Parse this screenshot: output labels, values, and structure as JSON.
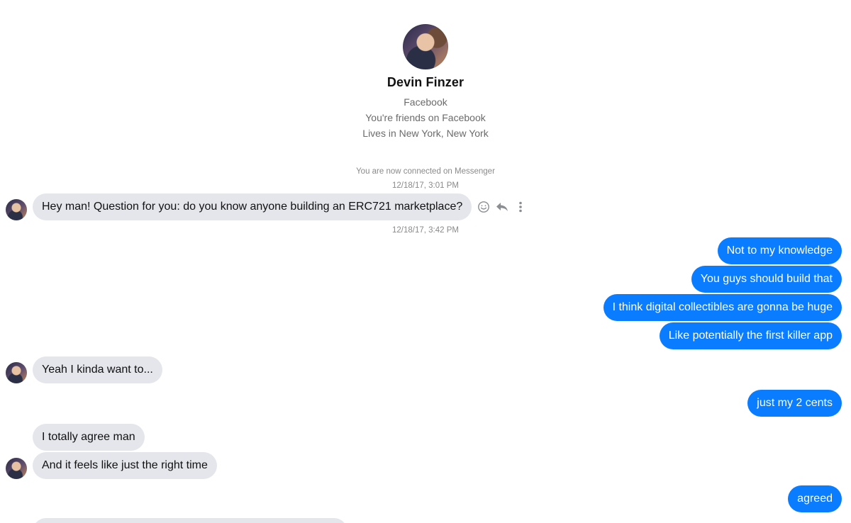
{
  "profile": {
    "name": "Devin Finzer",
    "line1": "Facebook",
    "line2": "You're friends on Facebook",
    "line3": "Lives in New York, New York"
  },
  "system": {
    "connected": "You are now connected on Messenger",
    "time1": "12/18/17, 3:01 PM",
    "time2": "12/18/17, 3:42 PM"
  },
  "messages": {
    "in1": "Hey man! Question for you: do you know anyone building an ERC721 marketplace?",
    "out1": "Not to my knowledge",
    "out2": "You guys should build that",
    "out3": "I think digital collectibles are gonna be huge",
    "out4": "Like potentially the first killer app",
    "in2": "Yeah I kinda want to...",
    "out5": "just my 2 cents",
    "in3": "I totally agree man",
    "in4": "And it feels like just the right time",
    "out6": "agreed"
  },
  "icons": {
    "react": "smiley-icon",
    "reply": "reply-icon",
    "more": "more-vertical-icon"
  },
  "colors": {
    "outgoing": "#0a7cff",
    "incoming": "#e4e6eb"
  }
}
